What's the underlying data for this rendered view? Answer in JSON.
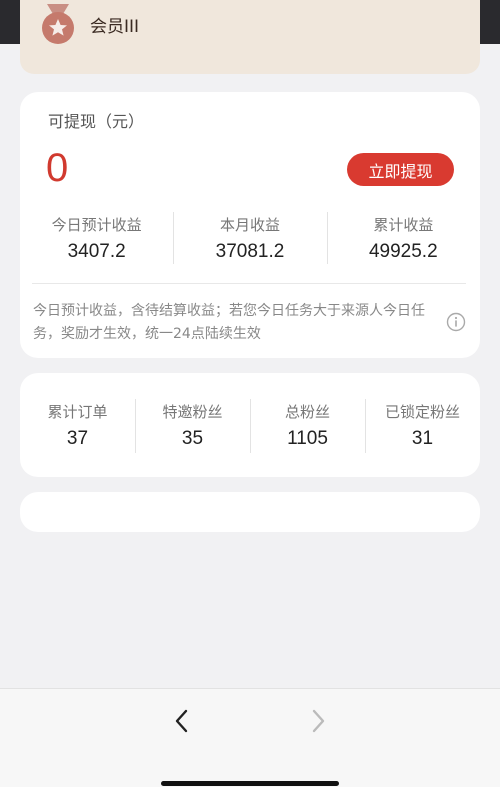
{
  "member": {
    "level_label": "会员III",
    "icon": "medal-star-icon"
  },
  "withdraw": {
    "label": "可提现（元）",
    "amount": "0",
    "button_label": "立即提现"
  },
  "earnings": [
    {
      "label": "今日预计收益",
      "value": "3407.2"
    },
    {
      "label": "本月收益",
      "value": "37081.2"
    },
    {
      "label": "累计收益",
      "value": "49925.2"
    }
  ],
  "note": {
    "text": "今日预计收益，含待结算收益；若您今日任务大于来源人今日任务，奖励才生效，统一24点陆续生效",
    "icon": "info-icon"
  },
  "counts": [
    {
      "label": "累计订单",
      "value": "37"
    },
    {
      "label": "特邀粉丝",
      "value": "35"
    },
    {
      "label": "总粉丝",
      "value": "1105"
    },
    {
      "label": "已锁定粉丝",
      "value": "31"
    }
  ],
  "colors": {
    "accent_red": "#d93a30",
    "member_bg": "#f0e7dc",
    "medal": "#c57a6c"
  }
}
